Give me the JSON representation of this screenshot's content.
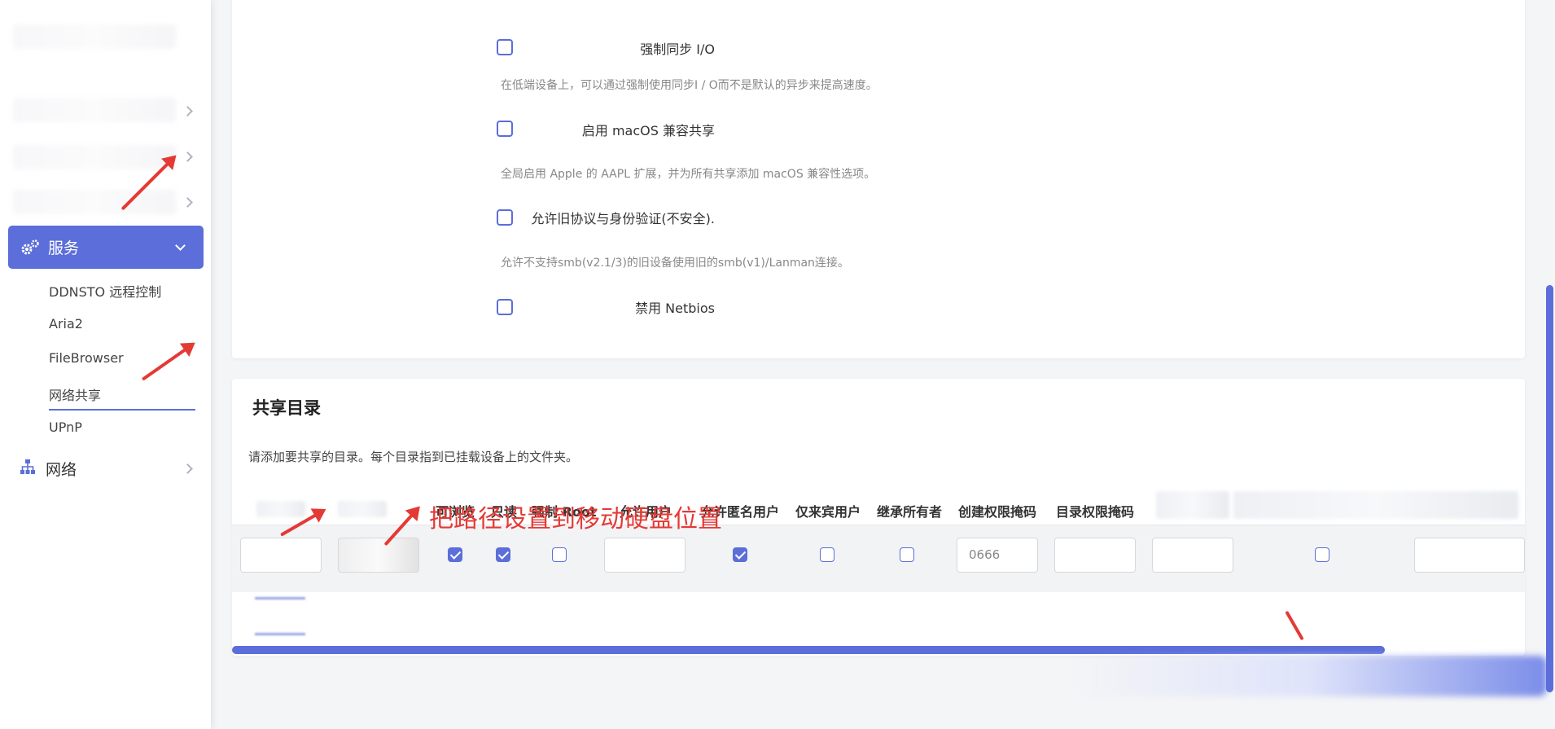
{
  "sidebar": {
    "active_menu": "服务",
    "submenu": [
      "DDNSTO 远程控制",
      "Aria2",
      "FileBrowser",
      "网络共享",
      "UPnP"
    ],
    "network_menu": "网络"
  },
  "options": [
    {
      "label": "强制同步 I/O",
      "desc": "在低端设备上，可以通过强制使用同步I / O而不是默认的异步来提高速度。",
      "checked": false
    },
    {
      "label": "启用 macOS 兼容共享",
      "desc": "全局启用 Apple 的 AAPL 扩展，并为所有共享添加 macOS 兼容性选项。",
      "checked": false
    },
    {
      "label": "允许旧协议与身份验证(不安全).",
      "desc": "允许不支持smb(v2.1/3)的旧设备使用旧的smb(v1)/Lanman连接。",
      "checked": false
    },
    {
      "label": "禁用 Netbios",
      "desc": "",
      "checked": false
    }
  ],
  "share": {
    "title": "共享目录",
    "desc": "请添加要共享的目录。每个目录指到已挂载设备上的文件夹。",
    "columns": [
      "可浏览",
      "只读",
      "强制 Root",
      "允许用户",
      "允许匿名用户",
      "仅来宾用户",
      "继承所有者",
      "创建权限掩码",
      "目录权限掩码"
    ],
    "row": {
      "browsable": true,
      "readonly": true,
      "force_root": false,
      "allow_guest": true,
      "guest_only": false,
      "inherit_owner": false,
      "create_mask": "0666",
      "extra_checkbox": false
    }
  },
  "annotation": {
    "text": "把路径设置到移动硬盘位置",
    "color": "#e53935"
  },
  "colors": {
    "accent": "#5b6ed9"
  }
}
